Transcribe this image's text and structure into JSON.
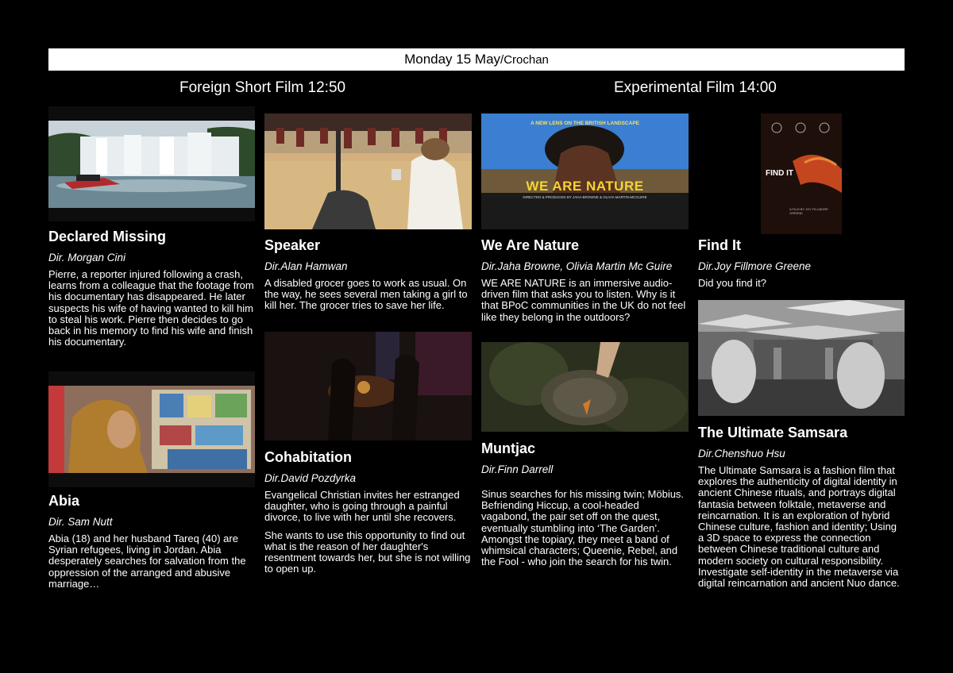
{
  "banner": {
    "day": "Monday 15 May",
    "venue": "/Crochan"
  },
  "sections": [
    {
      "label": "Foreign Short Film 12:50"
    },
    {
      "label": "Experimental Film 14:00"
    }
  ],
  "films": {
    "declared_missing": {
      "title": "Declared Missing",
      "director": "Dir. Morgan Cini",
      "description": "Pierre, a reporter injured following a crash, learns from a colleague that the footage from his documentary has disappeared. He later suspects his wife of having wanted to kill him to steal his work. Pierre then decides to go back in his memory to find his wife and finish his documentary."
    },
    "abia": {
      "title": "Abia",
      "director": "Dir. Sam Nutt",
      "description": "Abia (18) and her husband Tareq (40) are Syrian refugees, living in Jordan. Abia desperately searches for salvation from the oppression of the arranged and abusive marriage…"
    },
    "speaker": {
      "title": "Speaker",
      "director": "Dir.Alan Hamwan",
      "description": "A disabled grocer goes to work as usual. On the way, he sees several men taking a girl to kill her. The grocer tries to save her life."
    },
    "cohabitation": {
      "title": "Cohabitation",
      "director": "Dir.David Pozdyrka",
      "description": "Evangelical Christian invites her estranged daughter, who is going through a painful divorce, to live with her until she recovers.",
      "description_2": "She wants to use this opportunity to find out what is the reason of her daughter's resentment towards her, but she is not willing to open up."
    },
    "we_are_nature": {
      "title": "We Are Nature",
      "director": "Dir.Jaha Browne, Olivia Martin Mc Guire",
      "description": "WE ARE NATURE is an immersive audio-driven film that asks you to listen. Why is it that BPoC communities in the UK do not feel like they belong in the outdoors?",
      "poster": {
        "tagline": "A NEW LENS ON THE BRITISH LANDSCAPE",
        "title": "WE ARE NATURE",
        "credit": "DIRECTED & PRODUCED BY JAHA BROWNE & OLIVIA MARTIN-MCGUIRE"
      }
    },
    "muntjac": {
      "title": "Muntjac",
      "director": "Dir.Finn Darrell",
      "description": "Sinus searches for his missing twin; Möbius. Befriending Hiccup, a cool-headed vagabond, the pair set off on the quest, eventually stumbling into ‘The Garden’. Amongst the topiary, they meet a band of whimsical characters; Queenie, Rebel, and the Fool - who join the search for his twin."
    },
    "find_it": {
      "title": "Find It",
      "director": "Dir.Joy Fillmore Greene",
      "description": "Did you find it?",
      "poster": {
        "title": "FIND IT",
        "credit": "A FILM BY JOY FILLMORE GREENE"
      }
    },
    "ultimate_samsara": {
      "title": "The Ultimate Samsara",
      "director": "Dir.Chenshuo Hsu",
      "description": "The Ultimate Samsara is a fashion film that explores the authenticity of digital identity in ancient Chinese rituals, and portrays digital fantasia between folktale, metaverse and reincarnation. It is an exploration of hybrid Chinese culture, fashion and identity; Using a 3D space to express the connection between Chinese traditional culture and modern society on cultural responsibility. Investigate self-identity in the metaverse via digital reincarnation and ancient Nuo dance."
    }
  },
  "icons": {
    "declared_missing": "waterfall-boat-still",
    "abia": "woman-hijab-shop-still",
    "speaker": "motorbike-desert-still",
    "cohabitation": "dark-dining-room-still",
    "we_are_nature": "we-are-nature-poster",
    "muntjac": "hand-insect-forest-still",
    "find_it": "find-it-poster",
    "ultimate_samsara": "chinese-architecture-render"
  }
}
